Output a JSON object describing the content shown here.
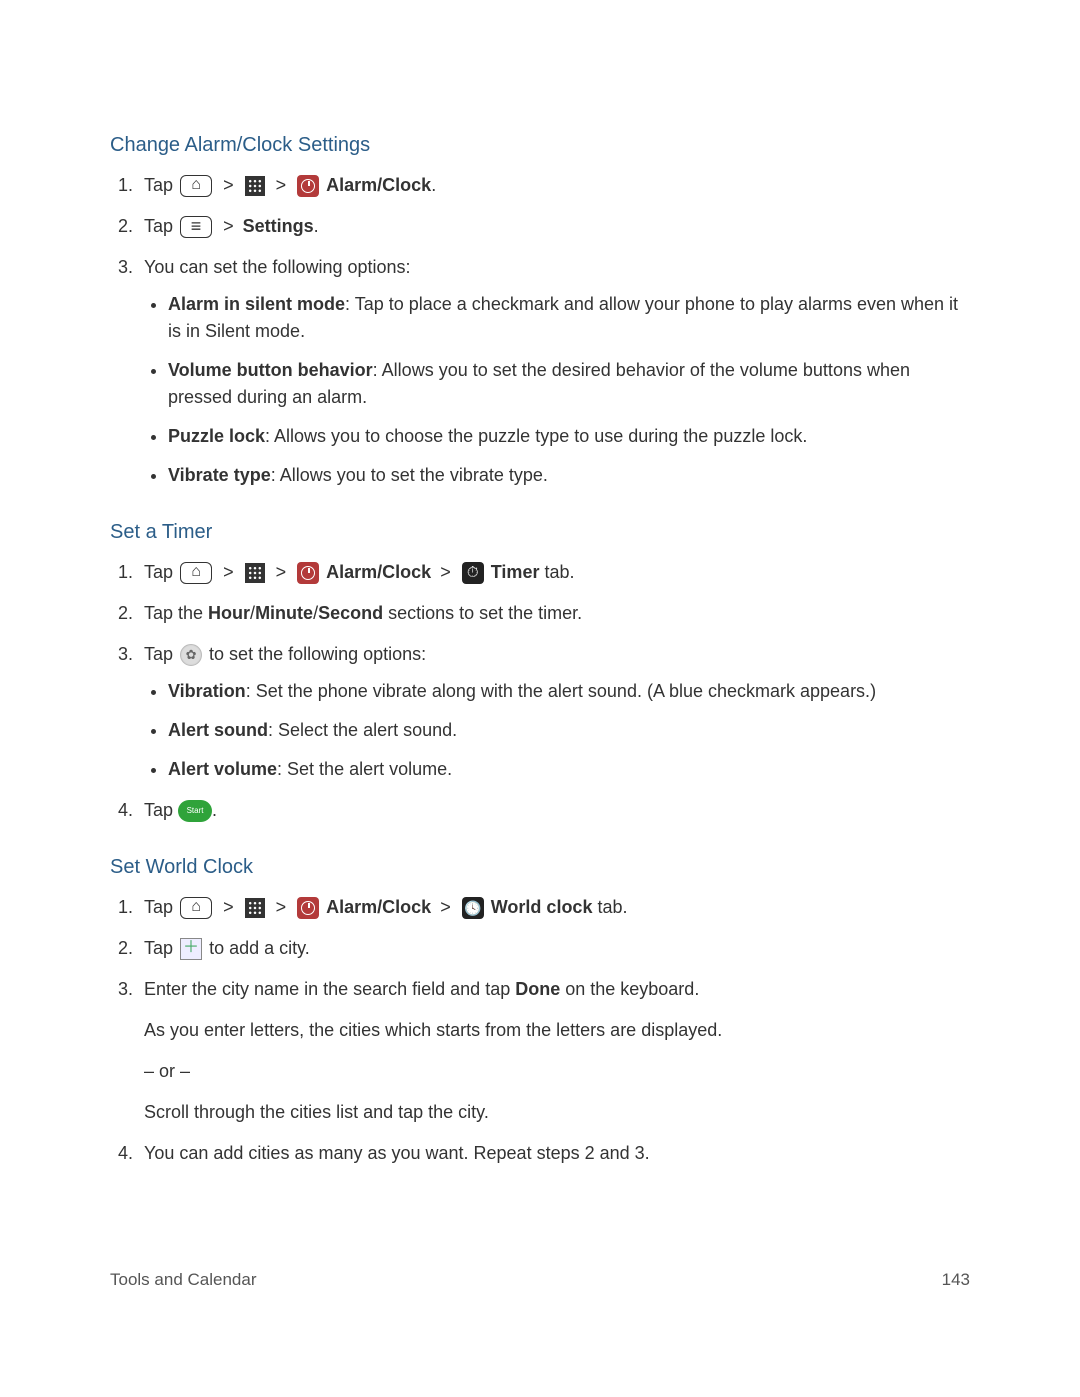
{
  "sections": {
    "s1": {
      "title": "Change Alarm/Clock Settings",
      "step1_tap": "Tap",
      "step1_alarmclock": " Alarm/Clock",
      "step2_tap": "Tap",
      "step2_settings": "Settings",
      "step3": "You can set the following options:",
      "opts": {
        "a_label": "Alarm in silent mode",
        "a_desc": ": Tap to place a checkmark and allow your phone to play alarms even when it is in Silent mode.",
        "b_label": "Volume button behavior",
        "b_desc": ": Allows you to set the desired behavior of the volume buttons when pressed during an alarm.",
        "c_label": "Puzzle lock",
        "c_desc": ": Allows you to choose the puzzle type to use during the puzzle lock.",
        "d_label": "Vibrate type",
        "d_desc": ": Allows you to set the vibrate type."
      }
    },
    "s2": {
      "title": "Set a Timer",
      "step1_tap": "Tap",
      "step1_alarmclock": " Alarm/Clock",
      "step1_timer": " Timer",
      "step1_tab": " tab.",
      "step2_a": "Tap the ",
      "step2_hour": "Hour",
      "step2_slash1": "/",
      "step2_minute": "Minute",
      "step2_slash2": "/",
      "step2_second": "Second",
      "step2_b": " sections to set the timer.",
      "step3_tap": "Tap ",
      "step3_rest": " to set the following options:",
      "opts": {
        "a_label": "Vibration",
        "a_desc": ": Set the phone vibrate along with the alert sound. (A blue checkmark appears.)",
        "b_label": "Alert sound",
        "b_desc": ": Select the alert sound.",
        "c_label": "Alert volume",
        "c_desc": ": Set the alert volume."
      },
      "step4_tap": "Tap "
    },
    "s3": {
      "title": "Set World Clock",
      "step1_tap": "Tap",
      "step1_alarmclock": " Alarm/Clock",
      "step1_world": " World clock",
      "step1_tab": " tab.",
      "step2_tap": "Tap",
      "step2_rest": " to add a city.",
      "step3_a": "Enter the city name in the search field and tap ",
      "step3_done": "Done",
      "step3_b": " on the keyboard.",
      "step3_p2": "As you enter letters, the cities which starts from the letters are displayed.",
      "step3_or": "– or –",
      "step3_p3": "Scroll through the cities list and tap the city.",
      "step4": "You can add cities as many as you want. Repeat steps 2 and 3."
    }
  },
  "misc": {
    "gt": ">",
    "period": "."
  },
  "footer": {
    "left": "Tools and Calendar",
    "right": "143"
  }
}
